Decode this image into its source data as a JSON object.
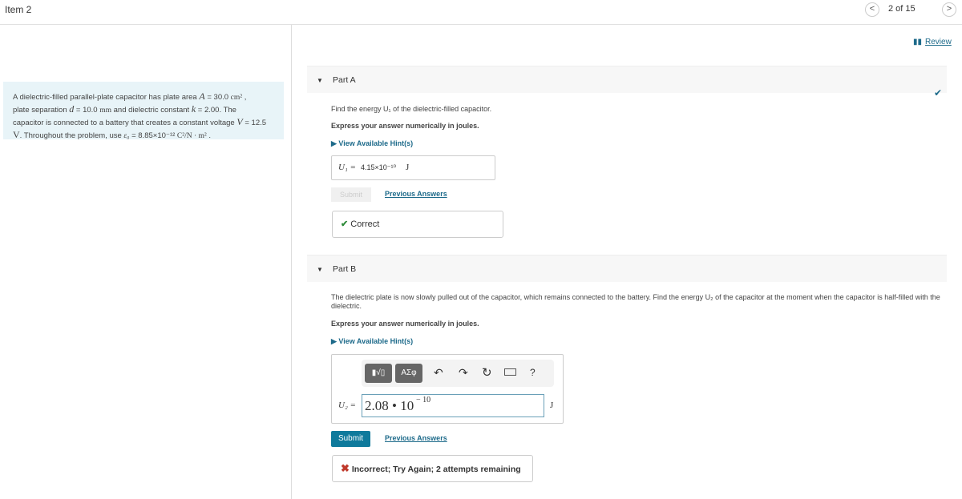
{
  "header": {
    "item_title": "Item 2",
    "prev_icon": "chevron-left",
    "next_icon": "chevron-right",
    "page_indicator": "2 of 15",
    "review_label": "Review"
  },
  "problem": {
    "line1": "A dielectric-filled parallel-plate capacitor has plate area ",
    "A": "A",
    "A_val": " = 30.0 ",
    "A_unit": "cm²",
    "line2": "plate separation ",
    "d": "d",
    "d_val": " = 10.0 ",
    "d_unit": "mm",
    "line2b": " and dielectric constant ",
    "k": "k",
    "k_val": " = 2.00. The",
    "line3": "capacitor is connected to a battery that creates a constant voltage ",
    "V": "V",
    "V_val": " = 12.5",
    "V_unit": "V",
    "line4": ". Throughout the problem, use ",
    "eps": "ε₀",
    "eps_val": " = 8.85×10⁻¹² ",
    "eps_unit": "C²/N · m²"
  },
  "partA": {
    "label": "Part A",
    "question": "Find the energy U₁ of the dielectric-filled capacitor.",
    "instruction": "Express your answer numerically in joules.",
    "hint": "View Available Hint(s)",
    "answer_label": "U₁ =",
    "answer_value": "4.15×10⁻¹⁰",
    "answer_unit": "J",
    "submit": "Submit",
    "previous": "Previous Answers",
    "feedback": "Correct",
    "status_color": "#2e8b3a"
  },
  "partB": {
    "label": "Part B",
    "question": "The dielectric plate is now slowly pulled out of the capacitor, which remains connected to the battery. Find the energy U₂ of the capacitor at the moment when the capacitor is half-filled with the dielectric.",
    "instruction": "Express your answer numerically in joules.",
    "hint": "View Available Hint(s)",
    "toolbar": {
      "templates": "▮√▯",
      "greek": "ΑΣφ",
      "undo": "undo",
      "redo": "redo",
      "reset": "reset",
      "keyboard": "keyboard",
      "help": "?"
    },
    "answer_label": "U₂ =",
    "answer_mantissa": "2.08 • 10",
    "answer_exponent": "− 10",
    "answer_unit": "J",
    "submit": "Submit",
    "previous": "Previous Answers",
    "feedback": "Incorrect; Try Again; 2 attempts remaining",
    "status_color": "#c0392b"
  },
  "colors": {
    "accent": "#1d6a8a",
    "submit_bg": "#0f7a9c",
    "problem_bg": "#e8f4f8"
  }
}
